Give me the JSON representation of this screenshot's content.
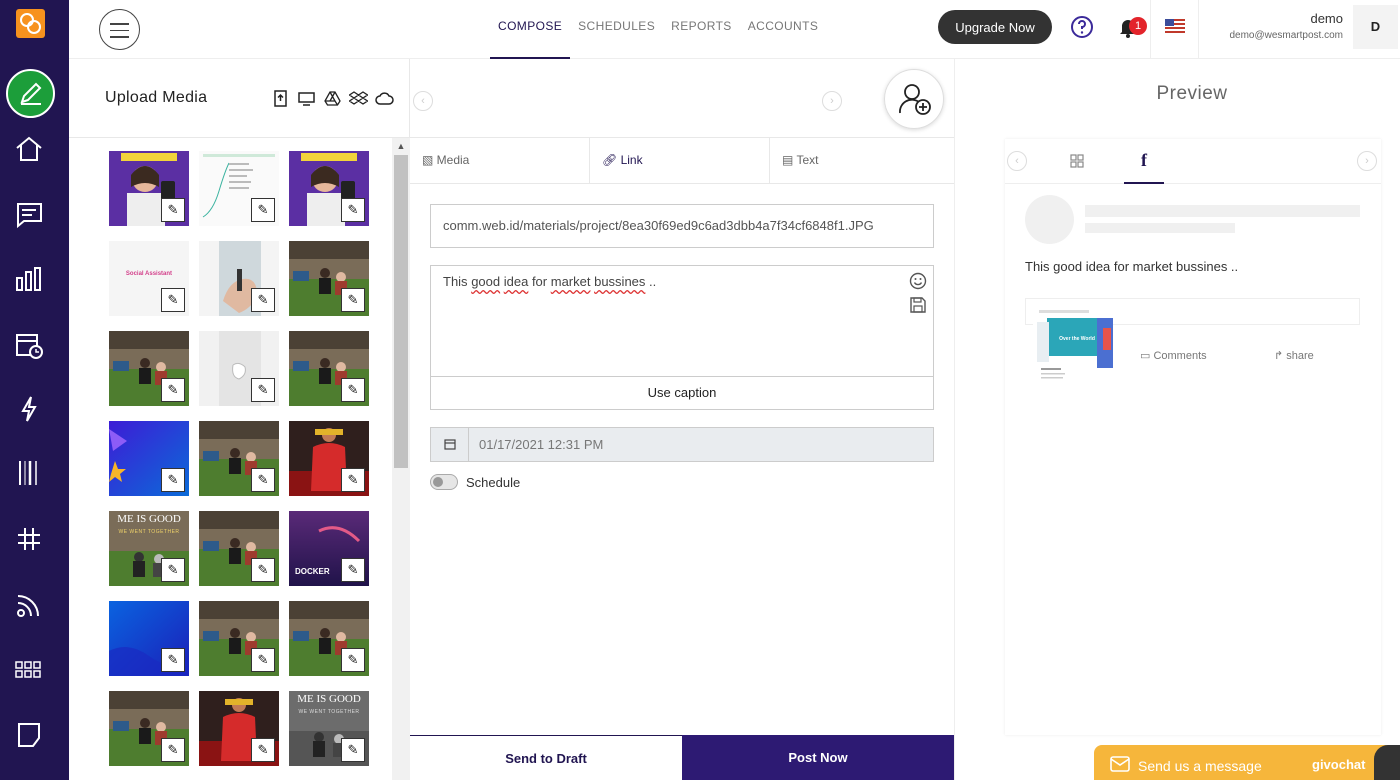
{
  "nav": {
    "items": [
      "compose-icon",
      "home-icon",
      "chat-icon",
      "reports-icon",
      "calendar-icon",
      "lightning-icon",
      "barcode-icon",
      "hashtag-icon",
      "rss-icon",
      "apps-icon",
      "note-icon"
    ]
  },
  "header": {
    "tabs": [
      {
        "label": "COMPOSE",
        "active": true
      },
      {
        "label": "SCHEDULES",
        "active": false
      },
      {
        "label": "REPORTS",
        "active": false
      },
      {
        "label": "ACCOUNTS",
        "active": false
      }
    ],
    "upgrade_label": "Upgrade Now",
    "notification_count": "1",
    "user_name": "demo",
    "user_email": "demo@wesmartpost.com",
    "avatar_initial": "D"
  },
  "media": {
    "title": "Upload Media",
    "source_icons": [
      "upload-icon",
      "desktop-icon",
      "google-drive-icon",
      "dropbox-icon",
      "cloud-icon"
    ],
    "thumbs": [
      {
        "kind": "woman-phone",
        "label": "",
        "caption": ""
      },
      {
        "kind": "chart-doc",
        "label": "",
        "caption": ""
      },
      {
        "kind": "woman-phone",
        "label": "",
        "caption": ""
      },
      {
        "kind": "social-text",
        "label": "Social Assistant",
        "caption": ""
      },
      {
        "kind": "hand-screw",
        "label": "",
        "caption": ""
      },
      {
        "kind": "people-field",
        "label": "",
        "caption": ""
      },
      {
        "kind": "people-field",
        "label": "",
        "caption": ""
      },
      {
        "kind": "glass",
        "label": "",
        "caption": ""
      },
      {
        "kind": "people-field",
        "label": "",
        "caption": ""
      },
      {
        "kind": "blue-star",
        "label": "",
        "caption": ""
      },
      {
        "kind": "people-field",
        "label": "",
        "caption": ""
      },
      {
        "kind": "red-person",
        "label": "",
        "caption": ""
      },
      {
        "kind": "game-good",
        "label": "ME IS GOOD",
        "caption": "WE WENT TOGETHER"
      },
      {
        "kind": "people-field",
        "label": "",
        "caption": ""
      },
      {
        "kind": "docker",
        "label": "DOCKER",
        "caption": ""
      },
      {
        "kind": "blue-wave",
        "label": "",
        "caption": ""
      },
      {
        "kind": "people-field",
        "label": "",
        "caption": ""
      },
      {
        "kind": "people-field",
        "label": "",
        "caption": ""
      },
      {
        "kind": "people-field",
        "label": "",
        "caption": ""
      },
      {
        "kind": "red-person",
        "label": "",
        "caption": ""
      },
      {
        "kind": "game-good-gray",
        "label": "ME IS GOOD",
        "caption": "WE WENT TOGETHER"
      }
    ]
  },
  "compose": {
    "tabs": [
      {
        "label": "Media",
        "icon": "image-icon",
        "active": false
      },
      {
        "label": "Link",
        "icon": "link-icon",
        "active": true
      },
      {
        "label": "Text",
        "icon": "file-icon",
        "active": false
      }
    ],
    "link_value": "comm.web.id/materials/project/8ea30f69ed9c6ad3dbb4a7f34cf6848f1.JPG",
    "caption_words": [
      "This",
      "good",
      "idea",
      "for",
      "market",
      "bussines",
      ".."
    ],
    "use_caption_label": "Use caption",
    "date_value": "01/17/2021 12:31 PM",
    "schedule_label": "Schedule",
    "schedule_on": false,
    "draft_label": "Send to Draft",
    "post_label": "Post Now"
  },
  "preview": {
    "title": "Preview",
    "tab_icons": [
      "grid-icon",
      "facebook-icon"
    ],
    "post_text": "This good idea for market bussines ..",
    "link_heading": "Over the World",
    "comments_label": "Comments",
    "share_label": "share"
  },
  "chat": {
    "placeholder": "Send us a message",
    "brand": "givochat"
  },
  "colors": {
    "nav_bg": "#211551",
    "accent": "#2d1a73",
    "green": "#1c9e3a",
    "orange": "#f7921e",
    "chat": "#f6b63b"
  }
}
